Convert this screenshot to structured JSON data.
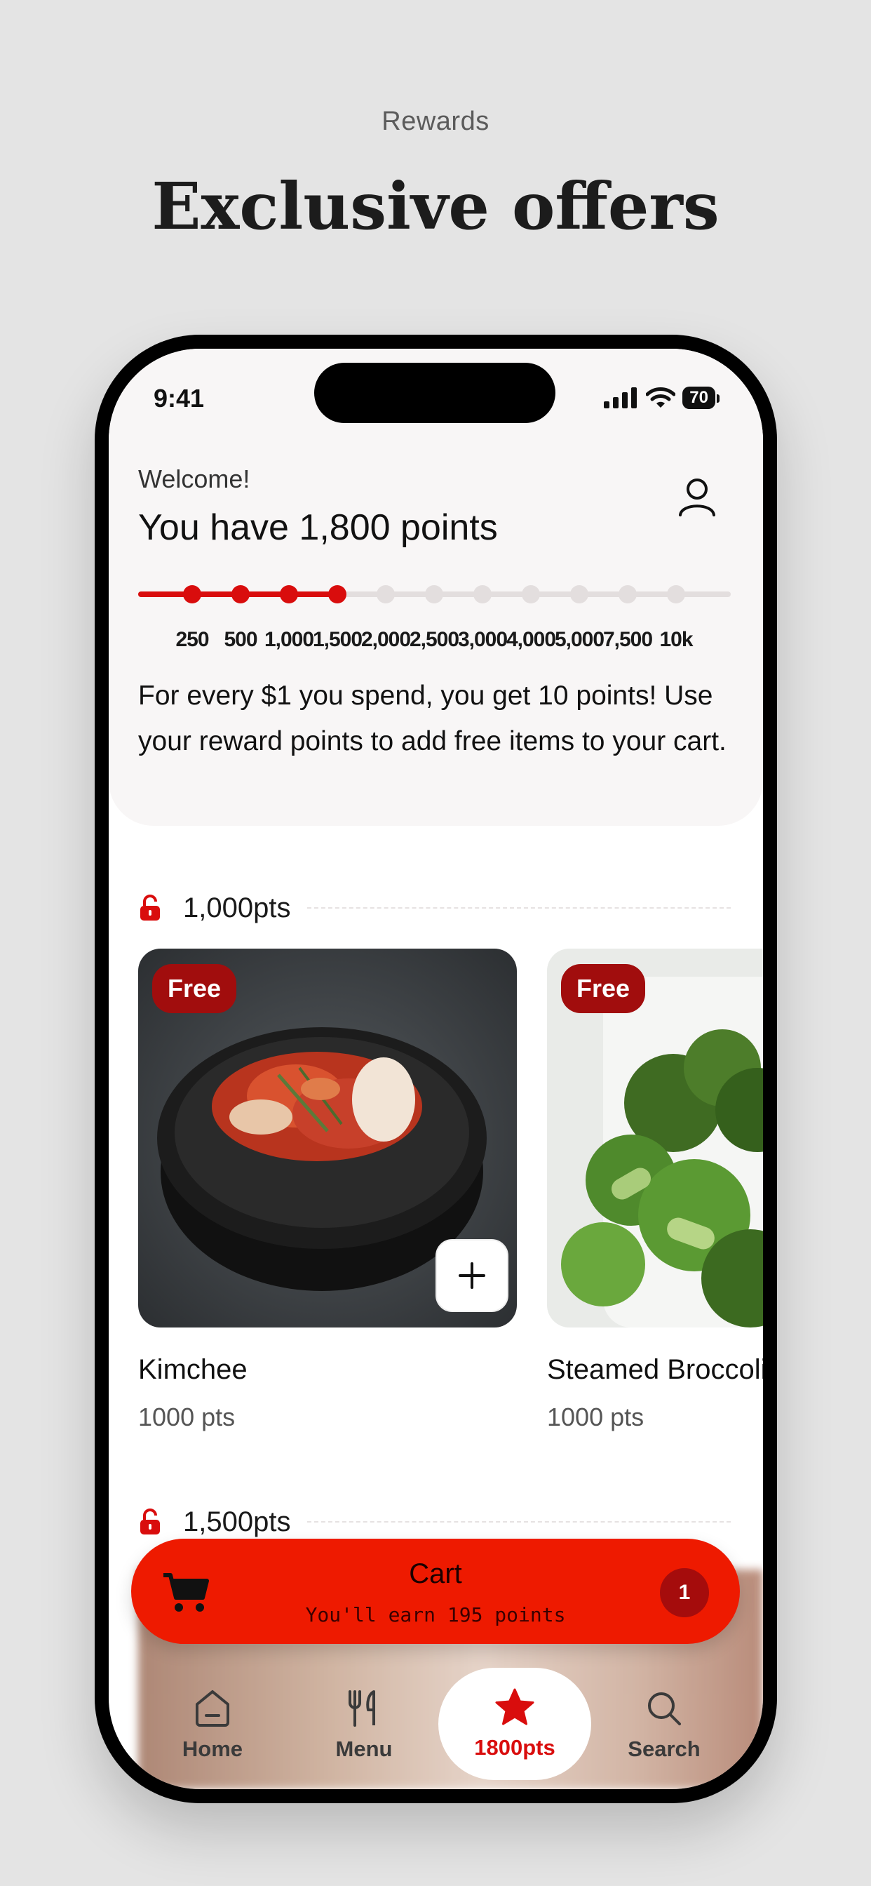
{
  "page": {
    "kicker": "Rewards",
    "headline": "Exclusive offers"
  },
  "status_bar": {
    "time": "9:41",
    "battery": "70"
  },
  "header": {
    "welcome": "Welcome!",
    "points_title": "You have 1,800 points",
    "user_icon": "user-icon"
  },
  "progress": {
    "current_points": 1800,
    "milestones": [
      "250",
      "500",
      "1,000",
      "1,500",
      "2,000",
      "2,500",
      "3,000",
      "4,000",
      "5,000",
      "7,500",
      "10k"
    ],
    "reached": 4
  },
  "info_text": "For every $1 you spend, you get 10 points! Use your reward points to add free items to your cart.",
  "tiers": [
    {
      "label": "1,000pts",
      "items": [
        {
          "badge": "Free",
          "name": "Kimchee",
          "points": "1000 pts"
        },
        {
          "badge": "Free",
          "name": "Steamed Broccoli",
          "points": "1000 pts"
        }
      ]
    },
    {
      "label": "1,500pts"
    }
  ],
  "cart": {
    "title": "Cart",
    "subtitle": "You'll earn 195 points",
    "count": "1"
  },
  "tabs": [
    {
      "label": "Home",
      "icon": "home-icon"
    },
    {
      "label": "Menu",
      "icon": "utensils-icon"
    },
    {
      "label": "1800pts",
      "icon": "star-icon",
      "active": true
    },
    {
      "label": "Search",
      "icon": "search-icon"
    }
  ],
  "colors": {
    "accent": "#d90d0d",
    "cart": "#ee1a00",
    "badge": "#a10d0d",
    "background": "#e4e4e4"
  }
}
